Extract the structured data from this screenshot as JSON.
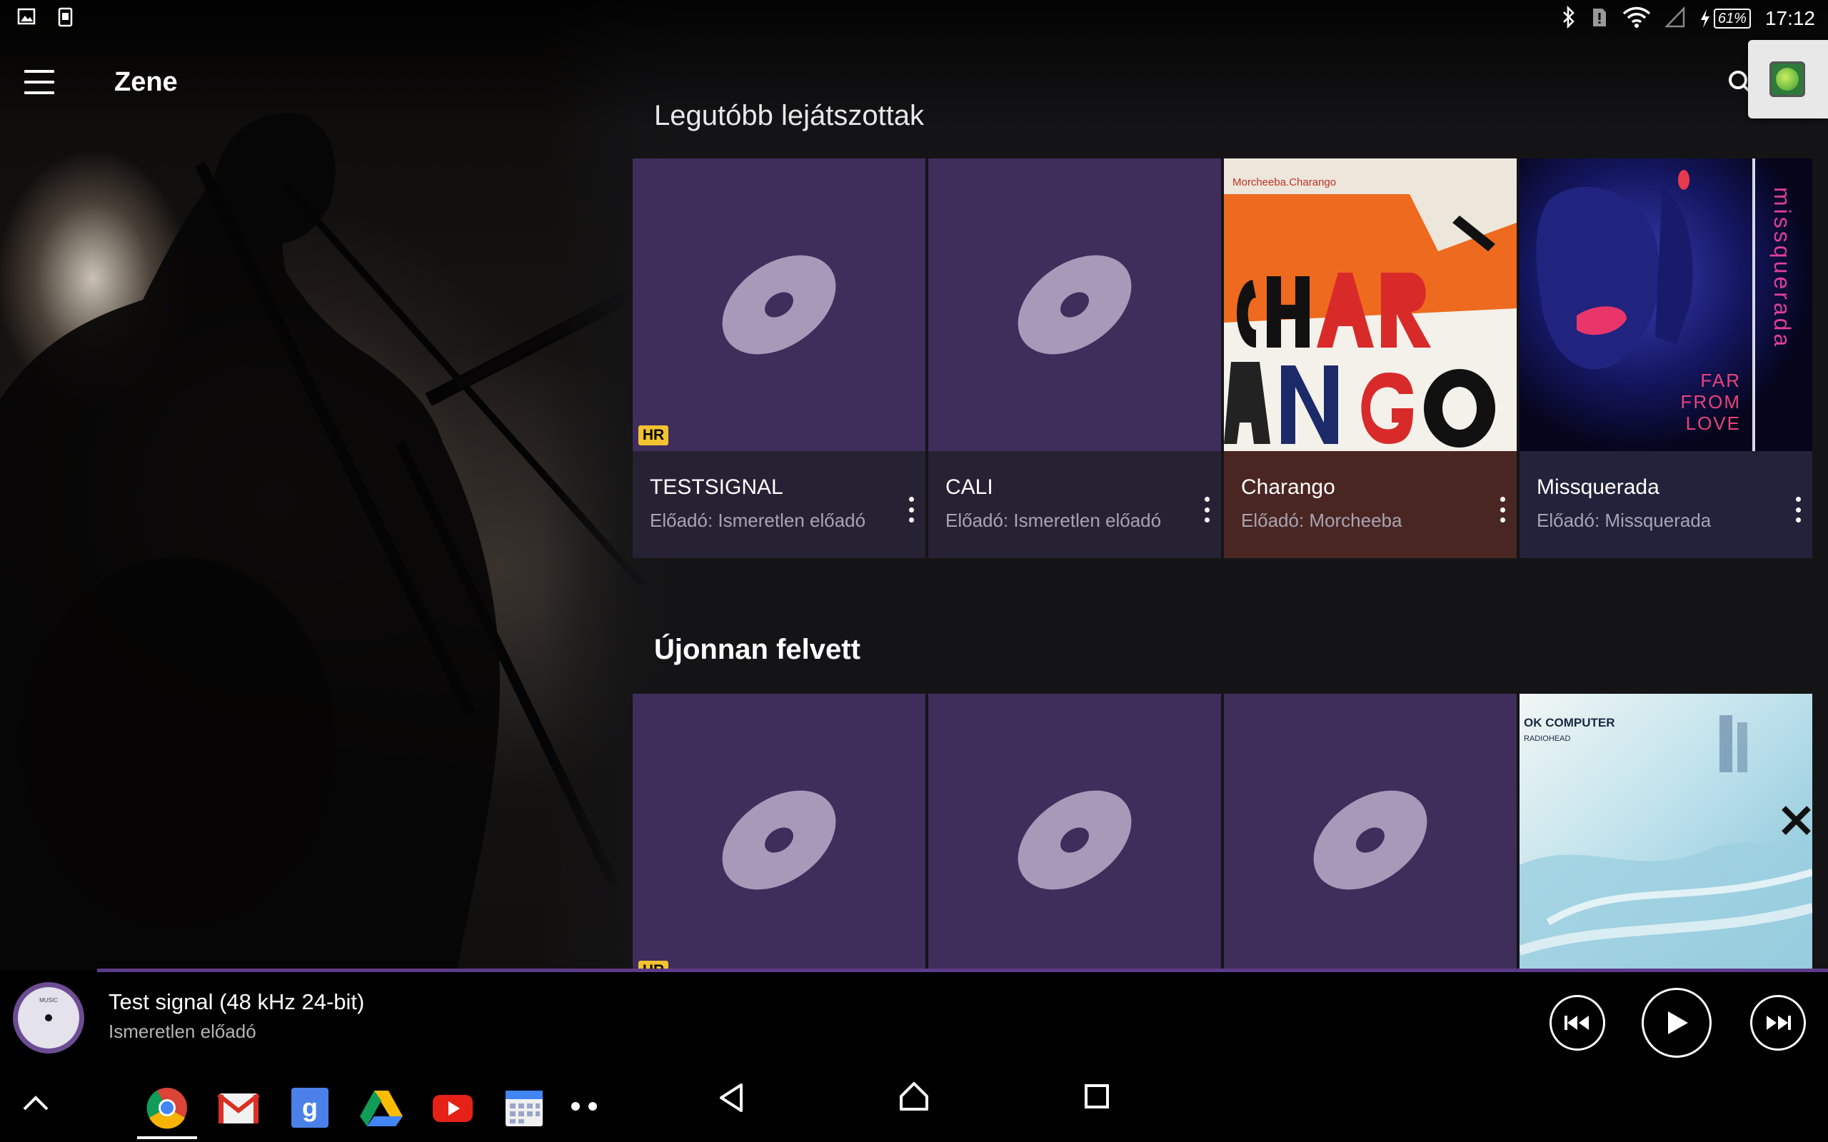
{
  "status_bar": {
    "time": "17:12",
    "battery": "61%",
    "icons": [
      "gallery-icon",
      "screenshot-icon",
      "bluetooth-icon",
      "sim-alert-icon",
      "wifi-icon",
      "cell-signal-icon",
      "charging-icon",
      "battery-icon"
    ]
  },
  "app_bar": {
    "title": "Zene",
    "icons": [
      "menu-icon",
      "search-icon"
    ]
  },
  "sections": [
    {
      "title": "Legutóbb lejátszottak",
      "cards": [
        {
          "title": "TESTSIGNAL",
          "subtitle": "Előadó: Ismeretlen előadó",
          "hr_badge": "HR",
          "info_color": "#262233"
        },
        {
          "title": "CALI",
          "subtitle": "Előadó: Ismeretlen előadó",
          "info_color": "#262233"
        },
        {
          "title": "Charango",
          "subtitle": "Előadó: Morcheeba",
          "info_color": "#4a2622"
        },
        {
          "title": "Missquerada",
          "subtitle": "Előadó: Missquerada",
          "info_color": "#22223a"
        }
      ]
    },
    {
      "title": "Újonnan felvett",
      "cards": [
        {
          "hr_badge": "HR"
        },
        {},
        {},
        {}
      ]
    }
  ],
  "album_art_text": {
    "charango_header": "Morcheeba.Charango",
    "missquerada_side": "missquerada",
    "missquerada_tag_1": "FAR",
    "missquerada_tag_2": "FROM",
    "missquerada_tag_3": "LOVE",
    "okc_title": "OK COMPUTER",
    "okc_artist": "RADIOHEAD"
  },
  "player": {
    "track_title": "Test signal (48 kHz 24-bit)",
    "track_artist": "Ismeretlen előadó",
    "art_label": "MUSIC",
    "progress_color": "#5e3b8a",
    "controls": [
      "previous-icon",
      "play-icon",
      "next-icon"
    ]
  },
  "nav_bar": {
    "apps": [
      "chrome-icon",
      "gmail-icon",
      "google-search-icon",
      "drive-icon",
      "youtube-icon",
      "calendar-icon",
      "more-apps-icon"
    ],
    "buttons": [
      "back-icon",
      "home-icon",
      "recents-icon"
    ]
  },
  "colors": {
    "placeholder_art": "#3f2d5c",
    "disc": "#a79ab9",
    "hr_badge": "#f2c230",
    "accent": "#5e3b8a"
  }
}
